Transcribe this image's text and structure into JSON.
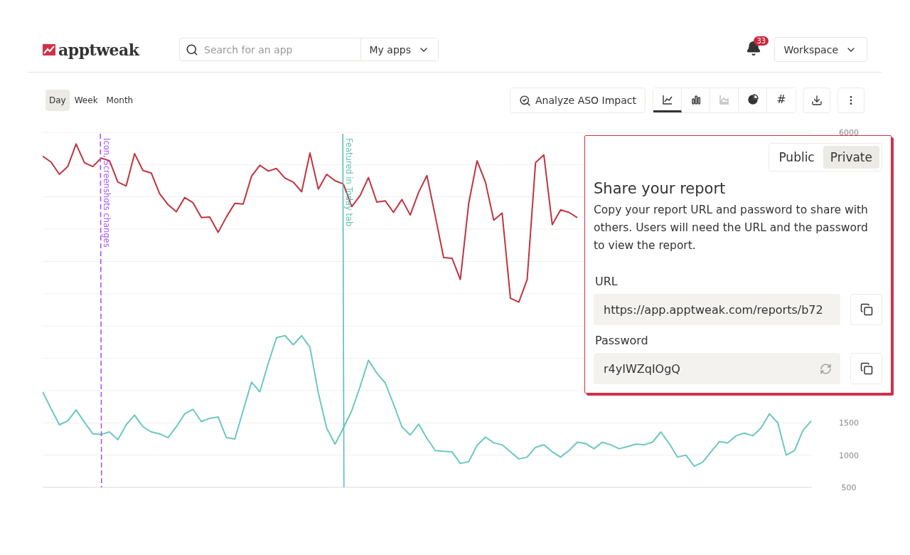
{
  "header": {
    "logo": "apptweak",
    "search": {
      "placeholder": "Search for an app"
    },
    "scope_dropdown": "My apps",
    "notifications": {
      "count": "33"
    },
    "workspace_dropdown": "Workspace"
  },
  "period_tabs": [
    {
      "label": "Day",
      "selected": true
    },
    {
      "label": "Week",
      "selected": false
    },
    {
      "label": "Month",
      "selected": false
    }
  ],
  "analyze_button": "Analyze ASO Impact",
  "chart_types": [
    {
      "kind": "line",
      "selected": true,
      "disabled": false
    },
    {
      "kind": "bar",
      "selected": false,
      "disabled": false
    },
    {
      "kind": "area",
      "selected": false,
      "disabled": true
    },
    {
      "kind": "pie",
      "selected": false,
      "disabled": false
    },
    {
      "kind": "number",
      "label": "#",
      "selected": false,
      "disabled": false
    }
  ],
  "chart": {
    "chart_data": {
      "type": "line",
      "ylim": [
        500,
        6000
      ],
      "yticks": [
        500,
        1000,
        1500,
        6000
      ],
      "series": [
        {
          "color": "#c0343f",
          "values": [
            5630,
            5540,
            5350,
            5470,
            5820,
            5530,
            5470,
            5600,
            5560,
            5230,
            5170,
            5670,
            5410,
            5370,
            5050,
            4880,
            4770,
            4990,
            4910,
            4680,
            4690,
            4450,
            4690,
            4900,
            4890,
            5320,
            5490,
            5400,
            5440,
            5290,
            5230,
            5080,
            5680,
            5120,
            5350,
            5250,
            5200,
            4850,
            5020,
            5300,
            4920,
            4940,
            4760,
            4960,
            4720,
            5070,
            5330,
            4700,
            4060,
            4050,
            3720,
            4900,
            5560,
            5230,
            4640,
            4750,
            3430,
            3370,
            3720,
            5530,
            5650,
            4570,
            4800,
            4760,
            4680,
            null,
            null,
            null,
            null,
            null,
            null,
            null,
            null,
            null,
            null,
            null,
            null,
            null,
            null,
            null,
            null,
            null,
            null,
            null,
            null,
            null,
            null,
            null,
            null,
            null,
            null,
            null,
            null
          ]
        },
        {
          "color": "#6cc8bf",
          "values": [
            1980,
            1720,
            1470,
            1530,
            1700,
            1510,
            1330,
            1320,
            1360,
            1240,
            1470,
            1620,
            1440,
            1360,
            1330,
            1270,
            1440,
            1640,
            1710,
            1520,
            1570,
            1590,
            1270,
            1250,
            1690,
            2130,
            1980,
            2420,
            2820,
            2850,
            2710,
            2850,
            2670,
            1960,
            1420,
            1170,
            1420,
            1690,
            2060,
            2470,
            2270,
            2120,
            1790,
            1440,
            1310,
            1480,
            1260,
            1070,
            1060,
            1050,
            870,
            900,
            1150,
            1280,
            1190,
            1160,
            1050,
            940,
            970,
            1120,
            1160,
            1050,
            970,
            1070,
            1200,
            1180,
            1100,
            1200,
            1160,
            1100,
            1130,
            1170,
            1160,
            1200,
            1360,
            1180,
            970,
            1000,
            830,
            890,
            1050,
            1210,
            1190,
            1300,
            1340,
            1300,
            1420,
            1640,
            1500,
            1000,
            1070,
            1380,
            1530
          ]
        }
      ],
      "annotations": [
        "Icon, Screenshots changes",
        "Featured in Today tab"
      ]
    },
    "event_markers": [
      {
        "color": "#a855f7",
        "dashed": true
      },
      {
        "color": "#5cbfb3",
        "dashed": false
      }
    ]
  },
  "share_panel": {
    "visibility": [
      {
        "label": "Public",
        "selected": false
      },
      {
        "label": "Private",
        "selected": true
      }
    ],
    "title": "Share your report",
    "description": "Copy your report URL and password to share with others. Users will need the URL and the password to view the report.",
    "url_label": "URL",
    "url": "https://app.apptweak.com/reports/b72",
    "password_label": "Password",
    "password": "r4yIWZqIOgQ"
  }
}
